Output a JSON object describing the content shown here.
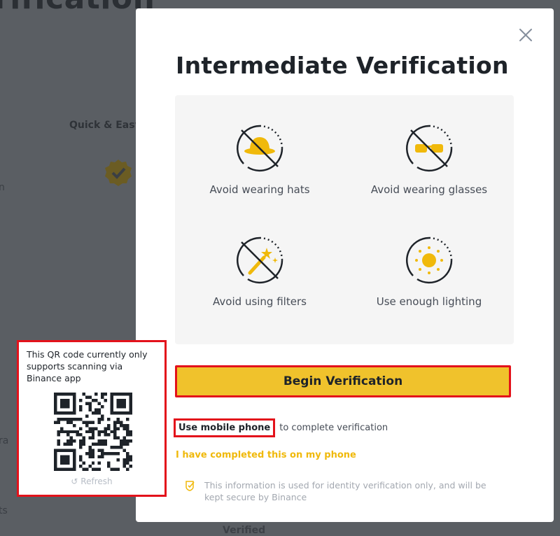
{
  "background": {
    "title": "rification",
    "quick_easy": "Quick & Easy",
    "left_n": "n",
    "left_ra": "ra",
    "left_ts": "ts",
    "bottom_text": "Verified"
  },
  "modal": {
    "title": "Intermediate Verification",
    "close_icon": "close-icon",
    "tips": [
      {
        "label": "Avoid wearing hats",
        "icon": "no-hat-icon"
      },
      {
        "label": "Avoid wearing glasses",
        "icon": "no-glasses-icon"
      },
      {
        "label": "Avoid using filters",
        "icon": "no-filter-icon"
      },
      {
        "label": "Use enough lighting",
        "icon": "lighting-icon"
      }
    ],
    "begin_button": "Begin Verification",
    "mobile_link": "Use mobile phone",
    "mobile_rest": "to complete verification",
    "completed_link": "I have completed this on my phone",
    "privacy_note": "This information is used for identity verification only,  and will be kept secure by Binance"
  },
  "qr_popover": {
    "text": "This QR code currently only supports scanning via Binance app",
    "refresh": "Refresh"
  },
  "colors": {
    "accent": "#f0c22c",
    "link_yellow": "#f0b90b",
    "highlight_red": "#e3121b"
  }
}
